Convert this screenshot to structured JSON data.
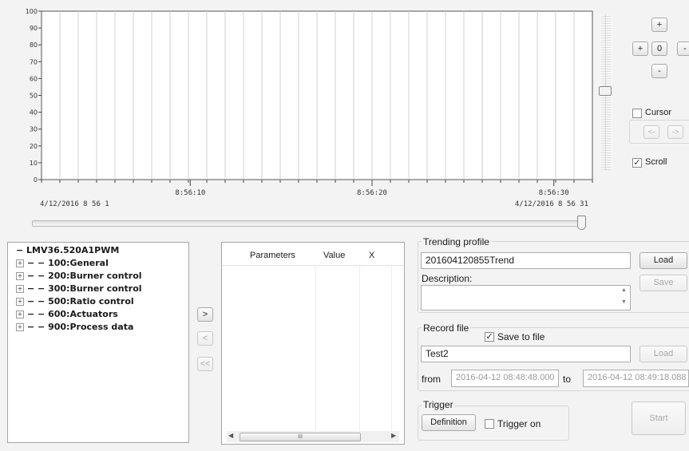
{
  "chart_data": {
    "type": "line",
    "y_ticks": [
      "0",
      "10",
      "20",
      "30",
      "40",
      "50",
      "60",
      "70",
      "80",
      "90",
      "100"
    ],
    "ylim": [
      0,
      100
    ],
    "x_tick_labels": [
      "8:56:10",
      "8:56:20",
      "8:56:30"
    ],
    "start_label": "4/12/2016 8 56 1",
    "end_label": "4/12/2016 8 56 31",
    "grid": true,
    "series": []
  },
  "zoom": {
    "plus_top": "+",
    "plus_left": "+",
    "value": "0",
    "minus_right": "-",
    "minus_bottom": "-"
  },
  "cursor": {
    "label": "Cursor",
    "checked": false,
    "prev_label": "<-",
    "next_label": "->"
  },
  "scroll": {
    "label": "Scroll",
    "checked": true
  },
  "tree": {
    "root": "LMV36.520A1PWM",
    "items": [
      "100:General",
      "200:Burner control",
      "300:Burner control",
      "500:Ratio control",
      "600:Actuators",
      "900:Process data"
    ]
  },
  "transfer": {
    "add": ">",
    "remove": "<",
    "remove_all": "<<"
  },
  "params_table": {
    "headers": [
      "Parameters",
      "Value",
      "X"
    ]
  },
  "trending": {
    "group_label": "Trending profile",
    "profile_name": "201604120855Trend",
    "load_label": "Load",
    "description_label": "Description:",
    "description_value": "",
    "save_label": "Save"
  },
  "record": {
    "group_label": "Record file",
    "save_to_file_label": "Save to file",
    "save_to_file_checked": true,
    "file_name": "Test2",
    "load_label": "Load",
    "from_label": "from",
    "from_value": "2016-04-12 08:48:48.000",
    "to_label": "to",
    "to_value": "2016-04-12 08:49:18.088"
  },
  "trigger": {
    "group_label": "Trigger",
    "definition_label": "Definition",
    "trigger_on_label": "Trigger on",
    "trigger_on_checked": false
  },
  "start_label": "Start",
  "hscroll_thumb": "III"
}
